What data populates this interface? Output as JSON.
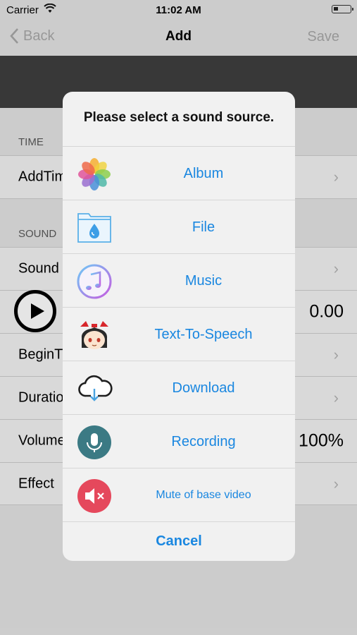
{
  "status": {
    "carrier": "Carrier",
    "time": "11:02 AM"
  },
  "nav": {
    "back": "Back",
    "title": "Add",
    "save": "Save"
  },
  "sections": {
    "time": "TIME",
    "sound": "SOUND"
  },
  "rows": {
    "add_time": "AddTim",
    "sound": "Sound",
    "play_value": "0.00",
    "begin_time": "BeginT",
    "duration": "Duratio",
    "volume": "Volume",
    "volume_value": "100%",
    "effect": "Effect"
  },
  "dialog": {
    "heading": "Please select a sound source.",
    "items": [
      {
        "label": "Album",
        "icon": "photos-icon"
      },
      {
        "label": "File",
        "icon": "folder-icon"
      },
      {
        "label": "Music",
        "icon": "music-note-icon"
      },
      {
        "label": "Text-To-Speech",
        "icon": "character-face-icon"
      },
      {
        "label": "Download",
        "icon": "cloud-download-icon"
      },
      {
        "label": "Recording",
        "icon": "microphone-icon"
      },
      {
        "label": "Mute of base video",
        "icon": "mute-speaker-icon"
      }
    ],
    "cancel": "Cancel"
  },
  "colors": {
    "accent": "#1a87e0",
    "dark_bar": "#3f3f3f",
    "mute": "#e5485c",
    "mic": "#3b7a84"
  }
}
